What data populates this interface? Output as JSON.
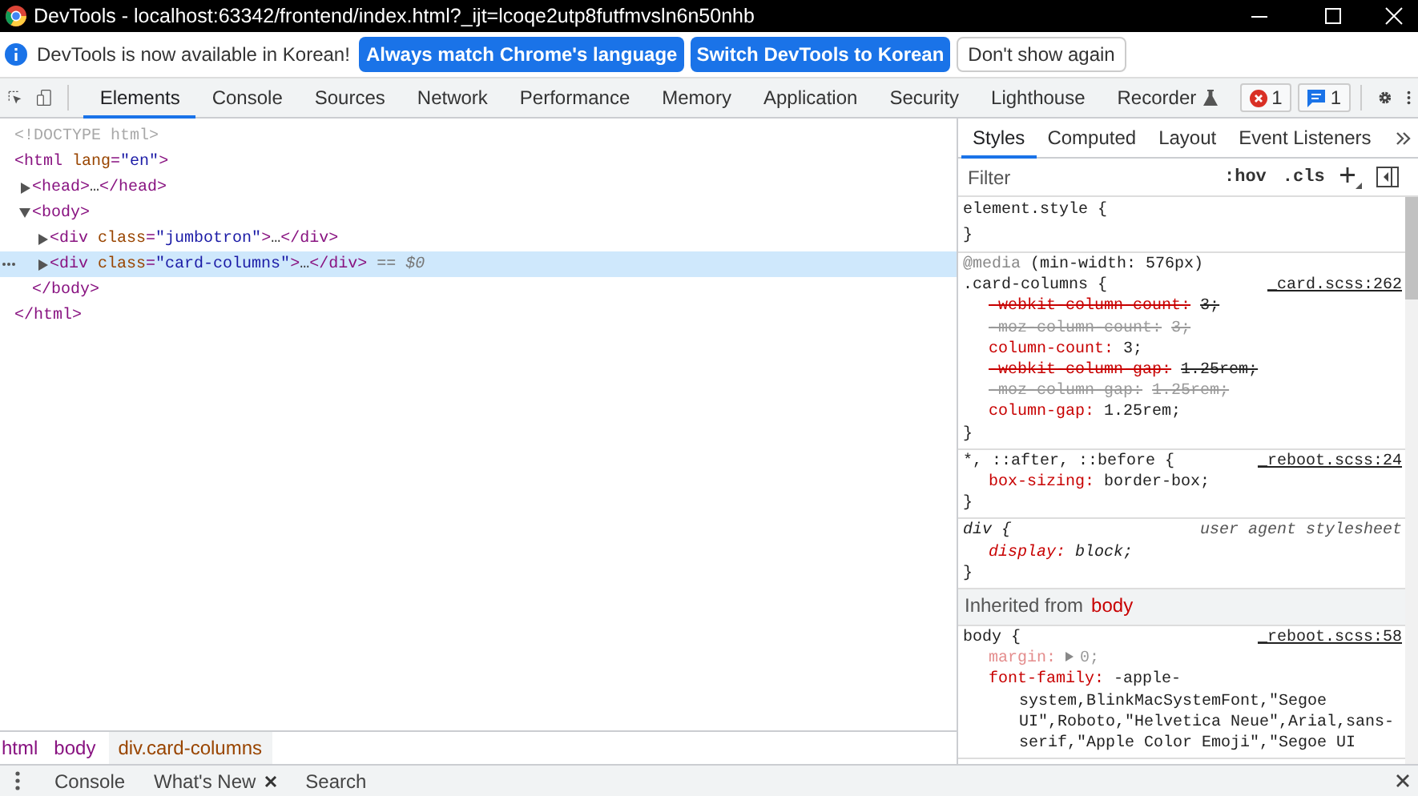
{
  "window": {
    "title": "DevTools - localhost:63342/frontend/index.html?_ijt=lcoqe2utp8futfmvsln6n50nhb"
  },
  "infobar": {
    "message": "DevTools is now available in Korean!",
    "buttons": [
      {
        "label": "Always match Chrome's language",
        "kind": "primary"
      },
      {
        "label": "Switch DevTools to Korean",
        "kind": "primary"
      },
      {
        "label": "Don't show again",
        "kind": "secondary"
      }
    ]
  },
  "main_tabs": [
    {
      "label": "Elements",
      "selected": true,
      "experimental": false
    },
    {
      "label": "Console",
      "selected": false,
      "experimental": false
    },
    {
      "label": "Sources",
      "selected": false,
      "experimental": false
    },
    {
      "label": "Network",
      "selected": false,
      "experimental": false
    },
    {
      "label": "Performance",
      "selected": false,
      "experimental": false
    },
    {
      "label": "Memory",
      "selected": false,
      "experimental": false
    },
    {
      "label": "Application",
      "selected": false,
      "experimental": false
    },
    {
      "label": "Security",
      "selected": false,
      "experimental": false
    },
    {
      "label": "Lighthouse",
      "selected": false,
      "experimental": false
    },
    {
      "label": "Recorder",
      "selected": false,
      "experimental": true
    }
  ],
  "issue_counters": [
    {
      "kind": "error",
      "count": "1"
    },
    {
      "kind": "message",
      "count": "1"
    }
  ],
  "dom_tree": [
    {
      "tokens": [
        {
          "kind": "doctype",
          "text": "<!DOCTYPE html>"
        }
      ],
      "selected": false
    },
    {
      "tokens": [
        {
          "kind": "tag",
          "text": "<html"
        },
        {
          "kind": "attr",
          "text": " lang"
        },
        {
          "kind": "tag",
          "text": "="
        },
        {
          "kind": "value",
          "text": "\"en\""
        },
        {
          "kind": "tag",
          "text": ">"
        }
      ],
      "selected": false,
      "children": [
        {
          "tokens": [
            {
              "kind": "tag",
              "text": "<head>"
            },
            {
              "kind": "text",
              "text": "…"
            },
            {
              "kind": "tag",
              "text": "</head>"
            }
          ],
          "expanded": false,
          "selected": false
        },
        {
          "tokens": [
            {
              "kind": "tag",
              "text": "<body>"
            }
          ],
          "expanded": true,
          "selected": false,
          "children": [
            {
              "tokens": [
                {
                  "kind": "tag",
                  "text": "<div"
                },
                {
                  "kind": "attr",
                  "text": " class"
                },
                {
                  "kind": "tag",
                  "text": "="
                },
                {
                  "kind": "value",
                  "text": "\"jumbotron\""
                },
                {
                  "kind": "tag",
                  "text": ">"
                },
                {
                  "kind": "text",
                  "text": "…"
                },
                {
                  "kind": "tag",
                  "text": "</div>"
                }
              ],
              "expanded": false,
              "selected": false
            },
            {
              "tokens": [
                {
                  "kind": "tag",
                  "text": "<div"
                },
                {
                  "kind": "attr",
                  "text": " class"
                },
                {
                  "kind": "tag",
                  "text": "="
                },
                {
                  "kind": "value",
                  "text": "\"card-columns\""
                },
                {
                  "kind": "tag",
                  "text": ">"
                },
                {
                  "kind": "text",
                  "text": "…"
                },
                {
                  "kind": "tag",
                  "text": "</div>"
                },
                {
                  "kind": "op",
                  "text": " == "
                },
                {
                  "kind": "var",
                  "text": "$0"
                }
              ],
              "expanded": false,
              "selected": true
            }
          ],
          "closing": [
            {
              "kind": "tag",
              "text": "</body>"
            }
          ]
        }
      ],
      "closing": [
        {
          "kind": "tag",
          "text": "</html>"
        }
      ]
    }
  ],
  "breadcrumbs": [
    {
      "text": "html",
      "selected": false
    },
    {
      "text": "body",
      "selected": false
    },
    {
      "text": "div.card-columns",
      "selected": true
    }
  ],
  "styles_pane": {
    "tabs": [
      {
        "label": "Styles",
        "selected": true
      },
      {
        "label": "Computed",
        "selected": false
      },
      {
        "label": "Layout",
        "selected": false
      },
      {
        "label": "Event Listeners",
        "selected": false
      }
    ],
    "filter": {
      "placeholder": "Filter"
    },
    "toggles": [
      ":hov",
      ".cls"
    ],
    "sections": [
      {
        "kind": "rule",
        "user_agent": false,
        "selector": "element.style {",
        "close": "}"
      },
      {
        "kind": "rule",
        "user_agent": false,
        "media": {
          "keyword": "@media",
          "query": " (min-width: 576px)"
        },
        "selector": ".card-columns {",
        "source": "_card.scss:262",
        "close": "}",
        "properties": [
          {
            "name": "-webkit-column-count:",
            "value": "3;",
            "overridden": true,
            "invalid": false,
            "inactive": false,
            "expandable": false
          },
          {
            "name": "-moz-column-count:",
            "value": "3;",
            "overridden": true,
            "invalid": true,
            "inactive": false,
            "expandable": false
          },
          {
            "name": "column-count:",
            "value": "3;",
            "overridden": false,
            "invalid": false,
            "inactive": false,
            "expandable": false
          },
          {
            "name": "-webkit-column-gap:",
            "value": "1.25rem;",
            "overridden": true,
            "invalid": false,
            "inactive": false,
            "expandable": false
          },
          {
            "name": "-moz-column-gap:",
            "value": "1.25rem;",
            "overridden": true,
            "invalid": true,
            "inactive": false,
            "expandable": false
          },
          {
            "name": "column-gap:",
            "value": "1.25rem;",
            "overridden": false,
            "invalid": false,
            "inactive": false,
            "expandable": false
          }
        ]
      },
      {
        "kind": "rule",
        "user_agent": false,
        "selector": "*, ::after, ::before {",
        "source": "_reboot.scss:24",
        "close": "}",
        "properties": [
          {
            "name": "box-sizing:",
            "value": "border-box;",
            "overridden": false,
            "invalid": false,
            "inactive": false,
            "expandable": false
          }
        ]
      },
      {
        "kind": "rule",
        "user_agent": true,
        "selector": "div {",
        "source": "user agent stylesheet",
        "close": "}",
        "properties": [
          {
            "name": "display:",
            "value": "block;",
            "overridden": false,
            "invalid": false,
            "inactive": false,
            "expandable": false
          }
        ]
      },
      {
        "kind": "inherited",
        "label": "Inherited from",
        "element": "body"
      },
      {
        "kind": "rule",
        "user_agent": false,
        "selector": "body {",
        "source": "_reboot.scss:58",
        "properties": [
          {
            "name": "margin:",
            "value": "0;",
            "overridden": false,
            "invalid": false,
            "inactive": true,
            "expandable": true
          },
          {
            "name": "font-family:",
            "value": "-apple-system,BlinkMacSystemFont,\"Segoe UI\",Roboto,\"Helvetica Neue\",Arial,sans-serif,\"Apple Color Emoji\",\"Segoe UI",
            "overridden": false,
            "invalid": false,
            "inactive": false,
            "expandable": false
          }
        ]
      }
    ]
  },
  "drawer": {
    "tabs": [
      {
        "label": "Console",
        "closable": false
      },
      {
        "label": "What's New",
        "closable": true
      },
      {
        "label": "Search",
        "closable": false
      }
    ]
  }
}
